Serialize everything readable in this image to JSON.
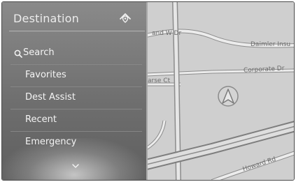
{
  "panel": {
    "title": "Destination",
    "menu": [
      {
        "label": "Search",
        "icon": "magnifier-icon"
      },
      {
        "label": "Favorites"
      },
      {
        "label": "Dest Assist"
      },
      {
        "label": "Recent"
      },
      {
        "label": "Emergency"
      }
    ]
  },
  "map": {
    "streets": {
      "top": "and W Dr",
      "daimler": "Daimler Insu",
      "corporate": "Corporate Dr",
      "left": "arse Ct",
      "howard": "Howard Rd"
    }
  },
  "colors": {
    "panel": "#7a7a7a",
    "map_background": "#cfcfcf",
    "road_fill": "#e8e8e8",
    "road_edge": "#8c8c8c"
  }
}
